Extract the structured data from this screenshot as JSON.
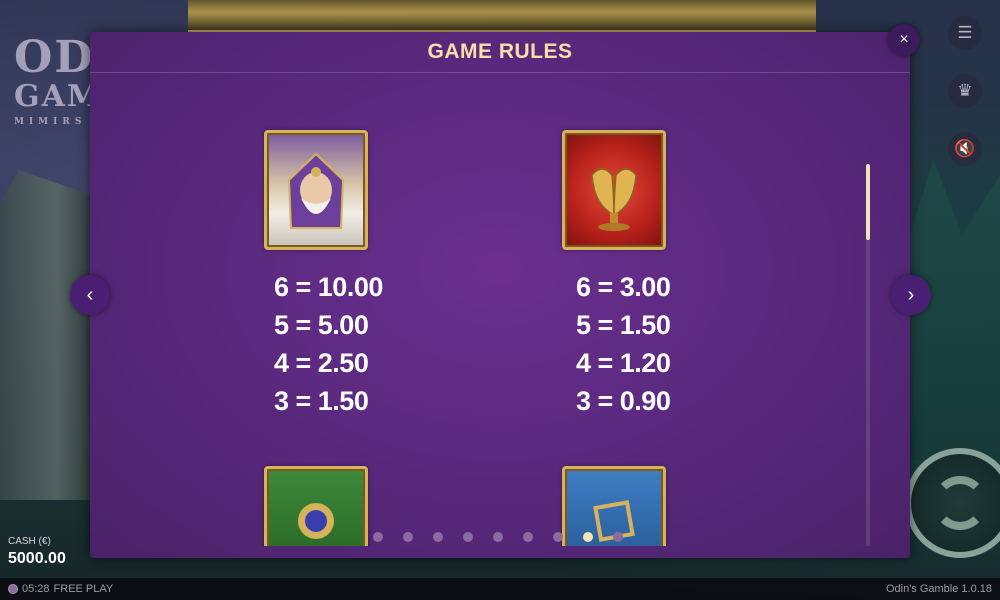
{
  "background": {
    "logo": {
      "line1": "ODIN'S",
      "line2": "GAMBLE",
      "line3": "MIMIRS"
    },
    "cash": {
      "label": "CASH (€)",
      "value": "5000.00"
    },
    "session": {
      "time": "05:28",
      "mode": "FREE PLAY"
    },
    "game_info": "Odin's Gamble  1.0.18",
    "icons": [
      "menu-icon",
      "trophy-icon",
      "sound-off-icon"
    ]
  },
  "modal": {
    "title": "GAME RULES",
    "close_icon": "×",
    "prev_icon": "‹",
    "next_icon": "›"
  },
  "symbols": [
    {
      "name": "odin",
      "icon": "wizard-icon",
      "payouts": [
        "6 = 10.00",
        "5 = 5.00",
        "4 = 2.50",
        "3 = 1.50"
      ]
    },
    {
      "name": "ravens",
      "icon": "ravens-icon",
      "payouts": [
        "6 = 3.00",
        "5 = 1.50",
        "4 = 1.20",
        "3 = 0.90"
      ]
    },
    {
      "name": "gem",
      "icon": "gem-icon",
      "payouts": []
    },
    {
      "name": "frame",
      "icon": "frame-icon",
      "payouts": []
    }
  ],
  "pagination": {
    "total": 9,
    "active_index": 7
  },
  "colors": {
    "modal_bg": "#58287c",
    "title": "#f7e0a8",
    "dot_active": "#f2e3b8",
    "dot_inactive": "#8e6aa3"
  }
}
